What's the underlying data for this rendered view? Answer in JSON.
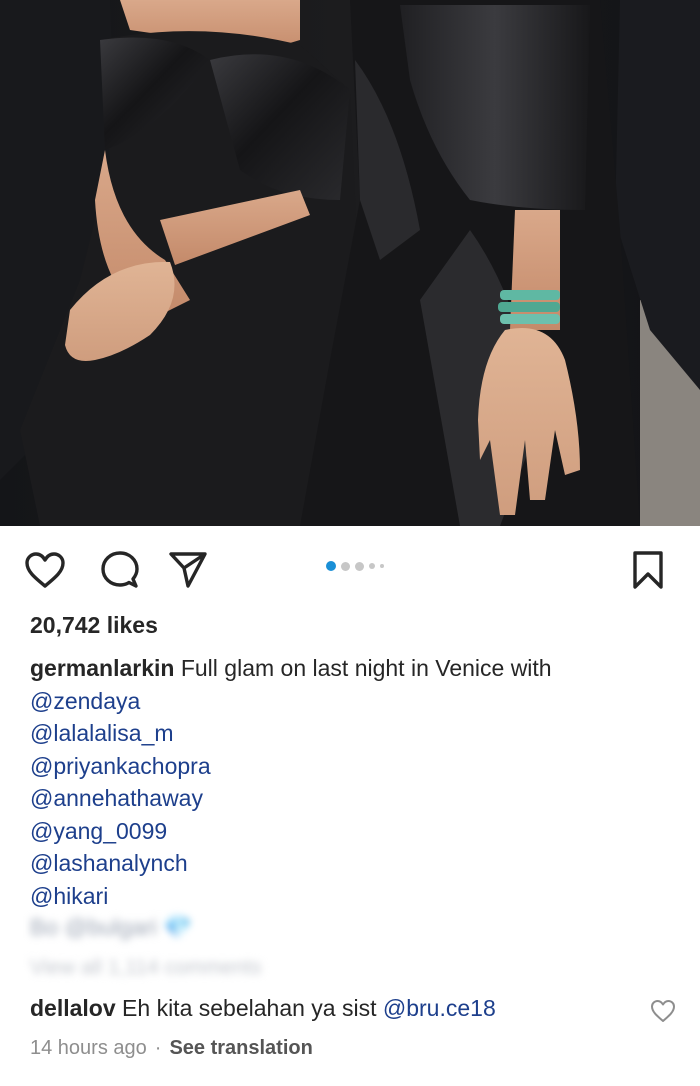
{
  "post": {
    "image_alt": "Two women in black satin gowns seated side by side",
    "carousel": {
      "count": 5,
      "active_index": 0,
      "active_color": "#1a8fd6"
    },
    "likes_text": "20,742 likes",
    "author": "germanlarkin",
    "caption_text": "Full glam on last night in Venice with",
    "mentions": [
      "@zendaya",
      "@lalalalisa_m",
      "@priyankachopra",
      "@annehathaway",
      "@yang_0099",
      "@lashanalynch",
      "@hikari"
    ],
    "blurred_line": "Bo @bulgari 💎",
    "view_comments": "View all 1,114 comments"
  },
  "actions": {
    "like_icon": "heart-icon",
    "comment_icon": "comment-icon",
    "share_icon": "share-icon",
    "save_icon": "bookmark-icon"
  },
  "comment": {
    "user": "dellalov",
    "text": "Eh kita sebelahan ya sist",
    "mention": "@bru.ce18",
    "time": "14 hours ago",
    "separator": "·",
    "translate": "See translation"
  },
  "colors": {
    "text": "#262626",
    "mention": "#1d3f8c",
    "secondary": "#8e8e8e",
    "accent": "#1a8fd6"
  }
}
